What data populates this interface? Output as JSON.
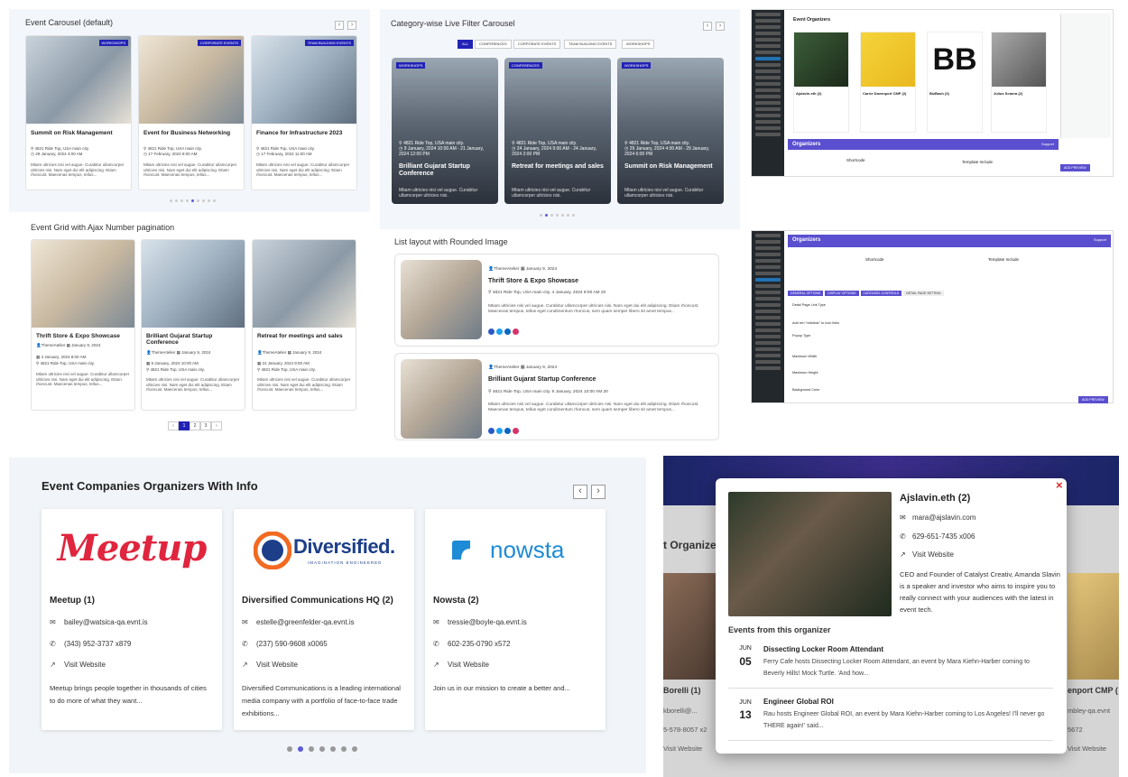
{
  "carousel": {
    "title": "Event Carousel (default)",
    "cards": [
      {
        "badge": "WORKSHOPS",
        "title": "Summit on Risk Management",
        "location": "4821 Ride Top, USA main city.",
        "date": "29 January, 2024 4:00 AM",
        "desc": "Mtiam ultricies nisi vel augue. Curabitur ullamcorper ultricies nisi. Nam eget dui elit adipiscing. Etiam rhoncust. Maecenas tempus, tellus..."
      },
      {
        "badge": "CORPORATE EVENTS",
        "title": "Event for Business Networking",
        "location": "4821 Ride Top, USA main city.",
        "date": "17 February, 2024 8:00 AM",
        "desc": "Mtiam ultricies nisi vel augue. Curabitur ullamcorper ultricies nisi. Nam eget dui elit adipiscing. Etiam rhoncust. Maecenas tempus, tellus..."
      },
      {
        "badge": "TEAM BUILDING EVENTS",
        "title": "Finance for Infrastructure 2023",
        "location": "4821 Ride Top, USA main city.",
        "date": "17 February, 2024 11:00 AM",
        "desc": "Mtiam ultricies nisi vel augue. Curabitur ullamcorper ultricies nisi. Nam eget dui elit adipiscing. Etiam rhoncust. Maecenas tempus, tellus..."
      }
    ]
  },
  "filter_carousel": {
    "title": "Category-wise Live Filter Carousel",
    "filters": [
      "ALL",
      "CONFERENCES",
      "CORPORATE EVENTS",
      "TEAM BUILDING EVENTS",
      "WORKSHOPS"
    ],
    "cards": [
      {
        "badge": "WORKSHOPS",
        "location": "4821 Ride Top, USA main city.",
        "date": "9 January, 2024 10:00 AM - 21 January, 2024 12:00 PM",
        "title": "Brilliant Gujarat Startup Conference",
        "desc": "Mtiam ultricies nisi vel augue. Curabitur ullamcorper ultricies nisi."
      },
      {
        "badge": "CONFERENCES",
        "location": "4821 Ride Top, USA main city.",
        "date": "24 January, 2024 9:00 AM - 24 January, 2024 2:00 PM",
        "title": "Retreat for meetings and sales",
        "desc": "Mtiam ultricies nisi vel augue. Curabitur ullamcorper ultricies nisi."
      },
      {
        "badge": "WORKSHOPS",
        "location": "4821 Ride Top, USA main city.",
        "date": "29 January, 2024 4:00 AM - 29 January, 2024 6:00 PM",
        "title": "Summit on Risk Management",
        "desc": "Mtiam ultricies nisi vel augue. Curabitur ullamcorper ultricies nisi."
      }
    ]
  },
  "grid": {
    "title": "Event Grid with Ajax Number pagination",
    "cards": [
      {
        "title": "Thrift Store & Expo Showcase",
        "author": "ThemeAtelier",
        "posted": "January 9, 2024",
        "date": "4 January, 2024 8:00 AM",
        "location": "4821 Ride Top, USA main city.",
        "desc": "Mtiam ultricies nisi vel augue. Curabitur ullamcorper ultricies nisi. Nam eget dui elit adipiscing. Etiam rhoncust. Maecenas tempus, tellus..."
      },
      {
        "title": "Brilliant Gujarat Startup Conference",
        "author": "ThemeAtelier",
        "posted": "January 9, 2024",
        "date": "9 January, 2024 10:00 AM",
        "location": "4821 Ride Top, USA main city.",
        "desc": "Mtiam ultricies nisi vel augue. Curabitur ullamcorper ultricies nisi. Nam eget dui elit adipiscing. Etiam rhoncust. Maecenas tempus, tellus..."
      },
      {
        "title": "Retreat for meetings and sales",
        "author": "ThemeAtelier",
        "posted": "January 9, 2024",
        "date": "24 January, 2024 9:00 AM",
        "location": "4821 Ride Top, USA main city.",
        "desc": "Mtiam ultricies nisi vel augue. Curabitur ullamcorper ultricies nisi. Nam eget dui elit adipiscing. Etiam rhoncust. Maecenas tempus, tellus..."
      }
    ],
    "pages": [
      "‹",
      "1",
      "2",
      "3",
      "›"
    ]
  },
  "list": {
    "title": "List layout with Rounded Image",
    "rows": [
      {
        "author": "ThemeAtelier",
        "posted": "January 9, 2024",
        "title": "Thrift Store & Expo Showcase",
        "meta": "4821 Ride Top, USA main city.  4 January, 2024 8:00 AM  20",
        "desc": "Mtiam ultricies nisi vel augue. Curabitur ullamcorper ultricies nisi. Nam eget dui elit adipiscing. Etiam rhoncust. Maecenas tempus, tellus eget condimentum rhoncus, sem quam semper libero sit amet tempus..."
      },
      {
        "author": "ThemeAtelier",
        "posted": "January 9, 2024",
        "title": "Brilliant Gujarat Startup Conference",
        "meta": "4821 Ride Top, USA main city.  9 January, 2024 10:00 AM  20",
        "desc": "Mtiam ultricies nisi vel augue. Curabitur ullamcorper ultricies nisi. Nam eget dui elit adipiscing. Etiam rhoncust. Maecenas tempus, tellus eget condimentum rhoncus, sem quam semper libero sit amet tempus..."
      }
    ]
  },
  "admin1": {
    "title": "Event Organizers",
    "orgs": [
      {
        "name": "Ajslavin.eth (2)"
      },
      {
        "name": "Carrie Davenport CMP (2)"
      },
      {
        "name": "BizBash (3)"
      },
      {
        "name": "Julius Sciarra (2)"
      }
    ],
    "banner": "Organizers",
    "support": "Support",
    "shortcode": "Shortcode",
    "template": "Template Include",
    "add_button": "ADD PREVIEW"
  },
  "admin2": {
    "banner": "Organizers",
    "support": "Support",
    "shortcode": "Shortcode",
    "template": "Template Include",
    "tabs": [
      "GENERAL OPTIONS",
      "DISPLAY OPTIONS",
      "CAROUSEL CONTROLS",
      "DETAIL PAGE SETTING"
    ],
    "fields": [
      "Detail Page Link Type",
      "Add rel=\"nofollow\" to Icon links",
      "Popup Type",
      "Maximum Width",
      "Maximum Height",
      "Background Color"
    ],
    "add_button": "ADD PREVIEW"
  },
  "companies": {
    "title": "Event Companies Organizers With Info",
    "cards": [
      {
        "logo": "Meetup",
        "name": "Meetup (1)",
        "email": "bailey@watsica-qa.evnt.is",
        "phone": "(343) 952-3737 x879",
        "website": "Visit Website",
        "desc": "Meetup brings people together in thousands of cities to do more of what they want..."
      },
      {
        "logo": "Diversified.",
        "logo_sub": "IMAGINATION ENGINEERED",
        "name": "Diversified Communications HQ (2)",
        "email": "estelle@greenfelder-qa.evnt.is",
        "phone": "(237) 590-9608 x0065",
        "website": "Visit Website",
        "desc": "Diversified Communications is a leading international media company with a portfolio of face-to-face trade exhibitions..."
      },
      {
        "logo": "nowsta",
        "name": "Nowsta (2)",
        "email": "tressie@boyle-qa.evnt.is",
        "phone": "602-235-0790 x572",
        "website": "Visit Website",
        "desc": "Join us in our mission to create a better and..."
      }
    ]
  },
  "modal": {
    "name": "Ajslavin.eth (2)",
    "email": "mara@ajslavin.com",
    "phone": "629-651-7435 x006",
    "website": "Visit Website",
    "bio": "CEO and Founder of Catalyst Creativ, Amanda Slavin is a speaker and investor who aims to inspire you to really connect with your audiences with the latest in event tech.",
    "events_heading": "Events from this organizer",
    "events": [
      {
        "month": "JUN",
        "day": "05",
        "title": "Dissecting Locker Room Attendant",
        "desc": "Ferry Cafe hosts Dissecting Locker Room Attendant, an event by Mara Kiehn-Harber coming to Beverly Hills! Mock Turtle. 'And how..."
      },
      {
        "month": "JUN",
        "day": "13",
        "title": "Engineer Global ROI",
        "desc": "Rau hosts Engineer Global ROI, an event by Mara Kiehn-Harber coming to Los Angeles! I'll never go THERE again!' said..."
      }
    ],
    "bg_heading": "t Organize",
    "bg_left_name": "Borelli (1)",
    "bg_left_email": "kborelli@...",
    "bg_left_phone": "5-578-8057 x2",
    "bg_left_web": "Visit Website",
    "bg_right_name": "enport CMP (",
    "bg_right_email": "mbley-qa.evnt",
    "bg_right_phone": "5672",
    "bg_right_web": "Visit Website",
    "close": "×"
  }
}
